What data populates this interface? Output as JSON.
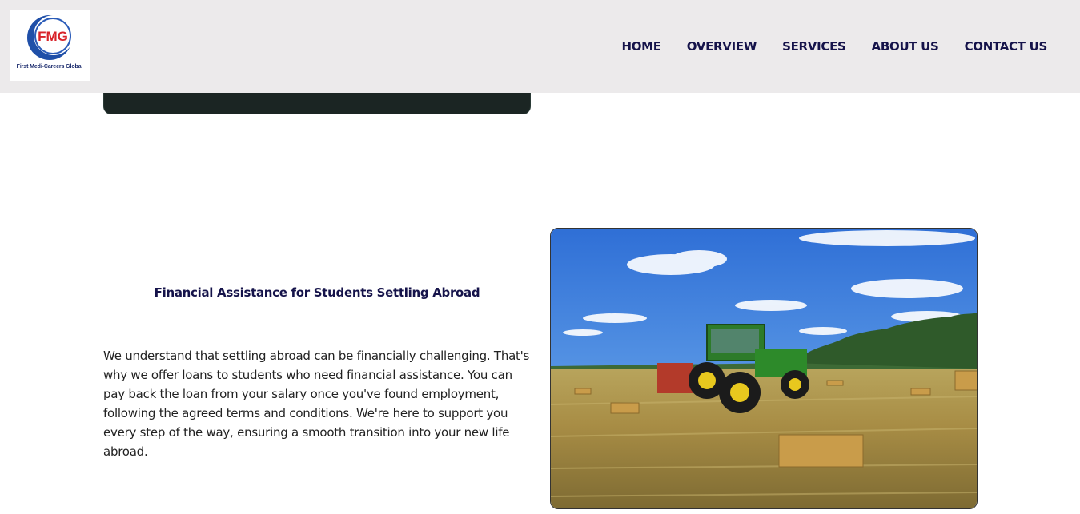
{
  "header": {
    "logo": {
      "mark": "FMG",
      "caption": "First Medi-Careers Global"
    },
    "nav": [
      {
        "label": "HOME"
      },
      {
        "label": "OVERVIEW"
      },
      {
        "label": "SERVICES"
      },
      {
        "label": "ABOUT US"
      },
      {
        "label": "CONTACT US"
      }
    ]
  },
  "section": {
    "title": "Financial Assistance for Students Settling Abroad",
    "body": "We understand that settling abroad can be financially challenging. That's why we offer loans to students who need financial assistance. You can pay back the loan from your salary once you've found employment, following the agreed terms and conditions. We're here to support you every step of the way, ensuring a smooth transition into your new life abroad."
  },
  "colors": {
    "header_bg": "#eceaeb",
    "nav_text": "#15134a",
    "logo_red": "#d8232a",
    "logo_blue": "#1f4fa8"
  }
}
